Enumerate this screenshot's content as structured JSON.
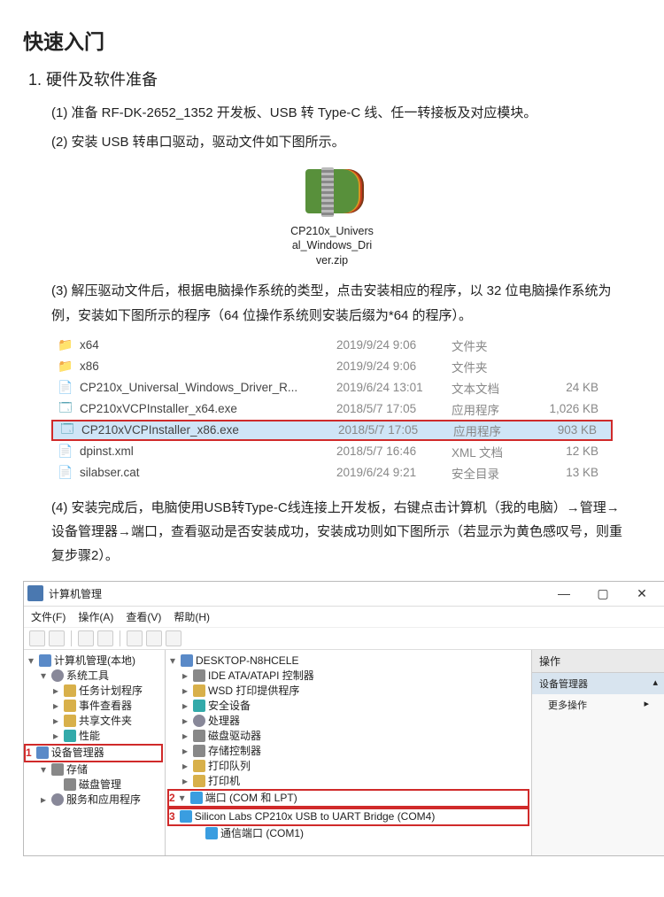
{
  "title": "快速入门",
  "section_heading": "1. 硬件及软件准备",
  "steps": {
    "s1": "(1) 准备 RF-DK-2652_1352 开发板、USB 转 Type-C 线、任一转接板及对应模块。",
    "s2": "(2) 安装 USB 转串口驱动，驱动文件如下图所示。",
    "s3": "(3) 解压驱动文件后，根据电脑操作系统的类型，点击安装相应的程序，以 32 位电脑操作系统为例，安装如下图所示的程序（64 位操作系统则安装后缀为*64 的程序）。",
    "s4": "(4) 安装完成后，电脑使用USB转Type-C线连接上开发板，右键点击计算机（我的电脑）→管理→设备管理器→端口，查看驱动是否安装成功，安装成功则如下图所示（若显示为黄色感叹号，则重复步骤2）。"
  },
  "zip_caption_l1": "CP210x_Univers",
  "zip_caption_l2": "al_Windows_Dri",
  "zip_caption_l3": "ver.zip",
  "explorer": [
    {
      "icon": "folder",
      "name": "x64",
      "date": "2019/9/24 9:06",
      "type": "文件夹",
      "size": ""
    },
    {
      "icon": "folder",
      "name": "x86",
      "date": "2019/9/24 9:06",
      "type": "文件夹",
      "size": ""
    },
    {
      "icon": "txt",
      "name": "CP210x_Universal_Windows_Driver_R...",
      "date": "2019/6/24 13:01",
      "type": "文本文档",
      "size": "24 KB"
    },
    {
      "icon": "exe",
      "name": "CP210xVCPInstaller_x64.exe",
      "date": "2018/5/7 17:05",
      "type": "应用程序",
      "size": "1,026 KB"
    },
    {
      "icon": "exe",
      "name": "CP210xVCPInstaller_x86.exe",
      "date": "2018/5/7 17:05",
      "type": "应用程序",
      "size": "903 KB",
      "hl": true
    },
    {
      "icon": "xml",
      "name": "dpinst.xml",
      "date": "2018/5/7 16:46",
      "type": "XML 文档",
      "size": "12 KB"
    },
    {
      "icon": "cat",
      "name": "silabser.cat",
      "date": "2019/6/24 9:21",
      "type": "安全目录",
      "size": "13 KB"
    }
  ],
  "mmc": {
    "title": "计算机管理",
    "menus": {
      "file": "文件(F)",
      "action": "操作(A)",
      "view": "查看(V)",
      "help": "帮助(H)"
    },
    "left_tree": {
      "root": "计算机管理(本地)",
      "system_tools": "系统工具",
      "task_sched": "任务计划程序",
      "event_viewer": "事件查看器",
      "shared": "共享文件夹",
      "perf": "性能",
      "devmgr": "设备管理器",
      "storage": "存储",
      "diskmgmt": "磁盘管理",
      "services": "服务和应用程序"
    },
    "markers": {
      "m1": "1",
      "m2": "2",
      "m3": "3"
    },
    "mid_tree": {
      "host": "DESKTOP-N8HCELE",
      "ide": "IDE ATA/ATAPI 控制器",
      "wsd": "WSD 打印提供程序",
      "security": "安全设备",
      "cpu": "处理器",
      "disk": "磁盘驱动器",
      "storage_ctrl": "存储控制器",
      "print_queue": "打印队列",
      "printer": "打印机",
      "ports": "端口 (COM 和 LPT)",
      "cp210x": "Silicon Labs CP210x USB to UART Bridge (COM4)",
      "com1": "通信端口 (COM1)"
    },
    "right": {
      "header": "操作",
      "sub": "设备管理器",
      "sub_caret": "▴",
      "more": "更多操作",
      "more_caret": "▸"
    }
  }
}
